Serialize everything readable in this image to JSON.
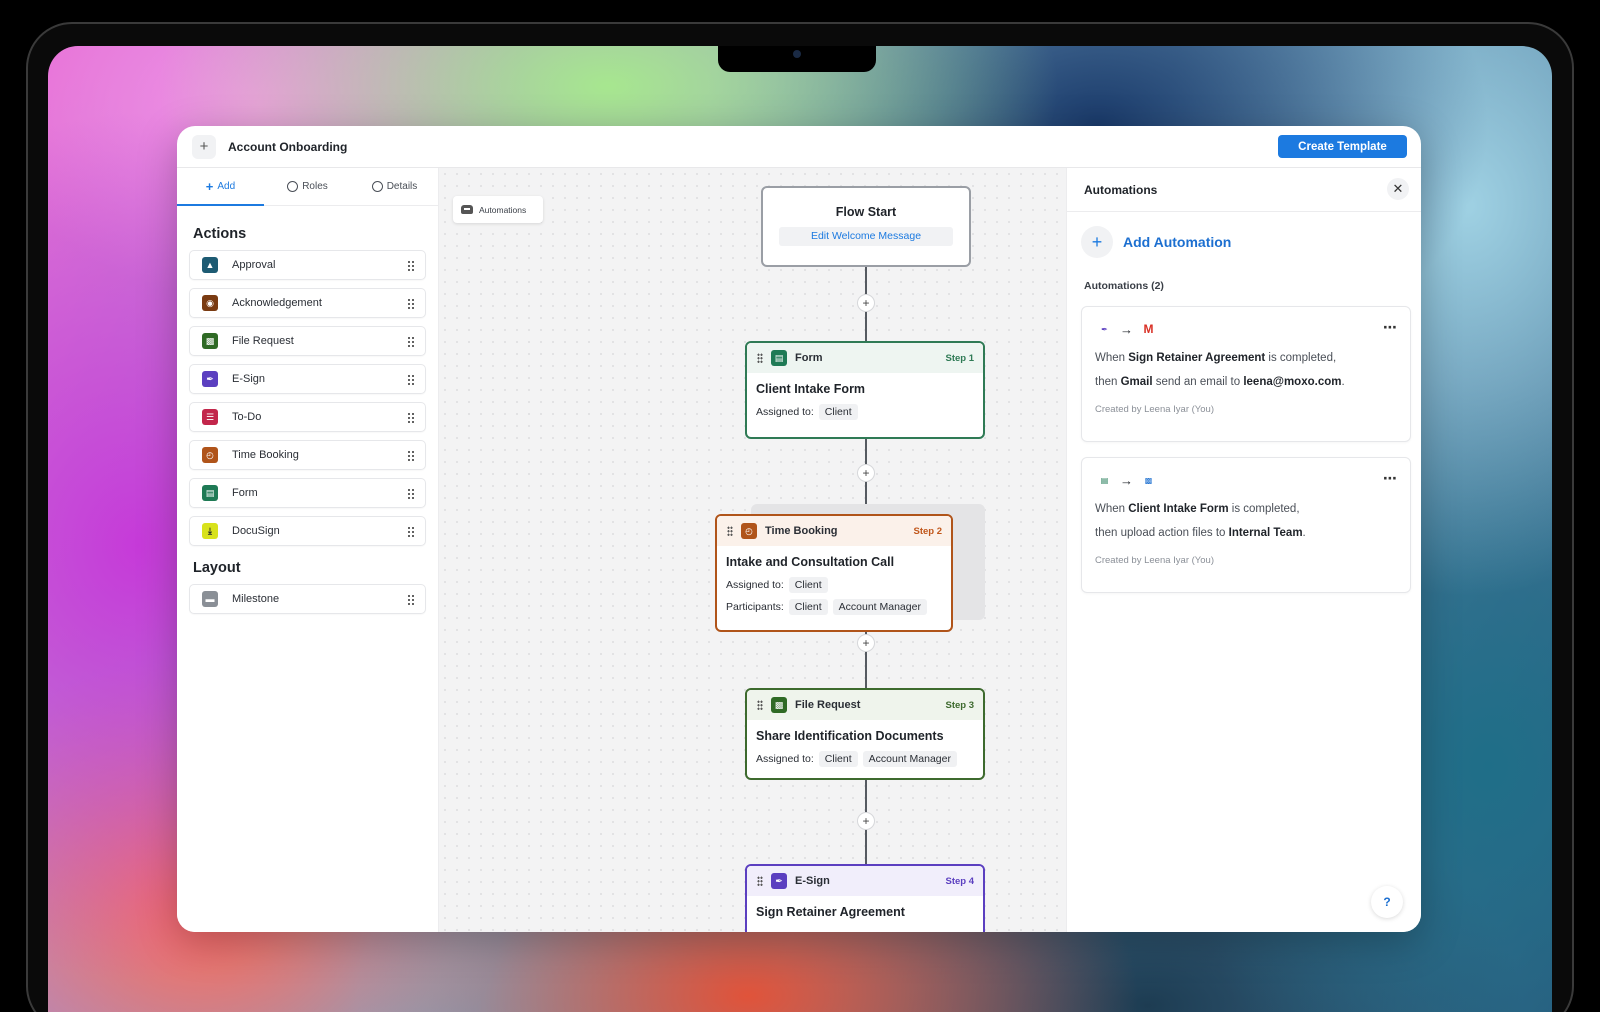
{
  "window": {
    "title": "Account Onboarding",
    "create_button": "Create Template"
  },
  "sidebar": {
    "tabs": [
      {
        "label": "Add"
      },
      {
        "label": "Roles"
      },
      {
        "label": "Details"
      }
    ],
    "actions_title": "Actions",
    "actions": [
      {
        "label": "Approval",
        "color": "#1d5b73"
      },
      {
        "label": "Acknowledgement",
        "color": "#7a3b12"
      },
      {
        "label": "File Request",
        "color": "#2f6a25"
      },
      {
        "label": "E-Sign",
        "color": "#5b3fc0"
      },
      {
        "label": "To-Do",
        "color": "#c2264b"
      },
      {
        "label": "Time Booking",
        "color": "#b0541a"
      },
      {
        "label": "Form",
        "color": "#1f7a55"
      },
      {
        "label": "DocuSign",
        "color": "#d8e21c"
      }
    ],
    "layout_title": "Layout",
    "layout_items": [
      {
        "label": "Milestone",
        "color": "#8a8f96"
      }
    ]
  },
  "canvas": {
    "automations_pill": "Automations",
    "flow_start": {
      "title": "Flow Start",
      "link": "Edit Welcome Message"
    },
    "steps": [
      {
        "type": "Form",
        "step": "Step 1",
        "name": "Client Intake Form",
        "assigned_label": "Assigned to:",
        "assigned": [
          "Client"
        ],
        "border": "#2f7a55",
        "head_bg": "#eef5f1",
        "step_color": "#2f7a55"
      },
      {
        "type": "Time Booking",
        "step": "Step 2",
        "name": "Intake and Consultation Call",
        "assigned_label": "Assigned to:",
        "assigned": [
          "Client"
        ],
        "participants_label": "Participants:",
        "participants": [
          "Client",
          "Account Manager"
        ],
        "border": "#b0541a",
        "head_bg": "#fbf1ea",
        "step_color": "#c0561a"
      },
      {
        "type": "File Request",
        "step": "Step 3",
        "name": "Share Identification Documents",
        "assigned_label": "Assigned to:",
        "assigned": [
          "Client",
          "Account Manager"
        ],
        "border": "#3d6a2e",
        "head_bg": "#eff4ec",
        "step_color": "#3d6a2e"
      },
      {
        "type": "E-Sign",
        "step": "Step 4",
        "name": "Sign Retainer Agreement",
        "border": "#5b3fc0",
        "head_bg": "#f1eefb",
        "step_color": "#5b3fc0"
      }
    ]
  },
  "panel": {
    "title": "Automations",
    "add_label": "Add Automation",
    "count_label": "Automations (2)",
    "items": [
      {
        "when_prefix": "When ",
        "when_target": "Sign Retainer Agreement",
        "when_suffix": " is completed,",
        "then_prefix": "then ",
        "then_app": "Gmail",
        "then_middle": " send an email to ",
        "then_target": "leena@moxo.com",
        "then_suffix": ".",
        "created": "Created by Leena Iyar (You)"
      },
      {
        "when_prefix": "When ",
        "when_target": "Client Intake Form",
        "when_suffix": " is completed,",
        "then_prefix": "then upload action files to ",
        "then_target": "Internal Team",
        "then_suffix": ".",
        "created": "Created by Leena Iyar (You)"
      }
    ],
    "help": "?"
  }
}
